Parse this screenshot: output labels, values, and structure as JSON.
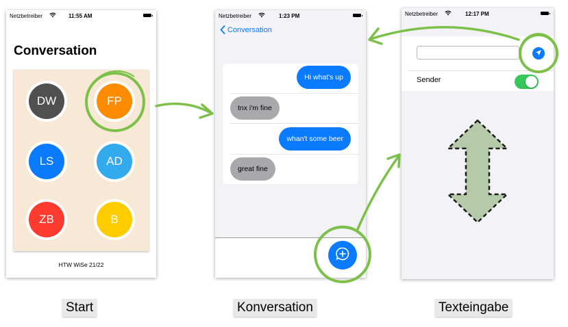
{
  "screens": {
    "start": {
      "status": {
        "carrier": "Netzbetreiber",
        "time": "11:55 AM"
      },
      "title": "Conversation",
      "contacts": [
        {
          "initials": "DW",
          "color": "#505050"
        },
        {
          "initials": "FP",
          "color": "#ff8c00"
        },
        {
          "initials": "LS",
          "color": "#0a7aff"
        },
        {
          "initials": "AD",
          "color": "#33aaee"
        },
        {
          "initials": "ZB",
          "color": "#ff3b30"
        },
        {
          "initials": "B",
          "color": "#ffcc00"
        }
      ],
      "footer": "HTW WiSe 21/22"
    },
    "conversation": {
      "status": {
        "carrier": "Netzbetreiber",
        "time": "1:23 PM"
      },
      "back_label": "Conversation",
      "messages": [
        {
          "text": "Hi what's up",
          "from": "me"
        },
        {
          "text": "tnx i'm fine",
          "from": "them"
        },
        {
          "text": "whan't some beer",
          "from": "me"
        },
        {
          "text": "great fine",
          "from": "them"
        }
      ],
      "fab_icon": "chat-plus-icon"
    },
    "input": {
      "status": {
        "carrier": "Netzbetreiber",
        "time": "12:17 PM"
      },
      "input_value": "",
      "send_icon": "paper-plane-icon",
      "sender_label": "Sender",
      "sender_toggle_on": true
    }
  },
  "captions": {
    "start": "Start",
    "conversation": "Konversation",
    "input": "Texteingabe"
  },
  "colors": {
    "accent": "#0a7aff",
    "highlight": "#7cc04a",
    "arrow_fill": "#b5caa8",
    "card_bg": "#f8e9d7"
  }
}
